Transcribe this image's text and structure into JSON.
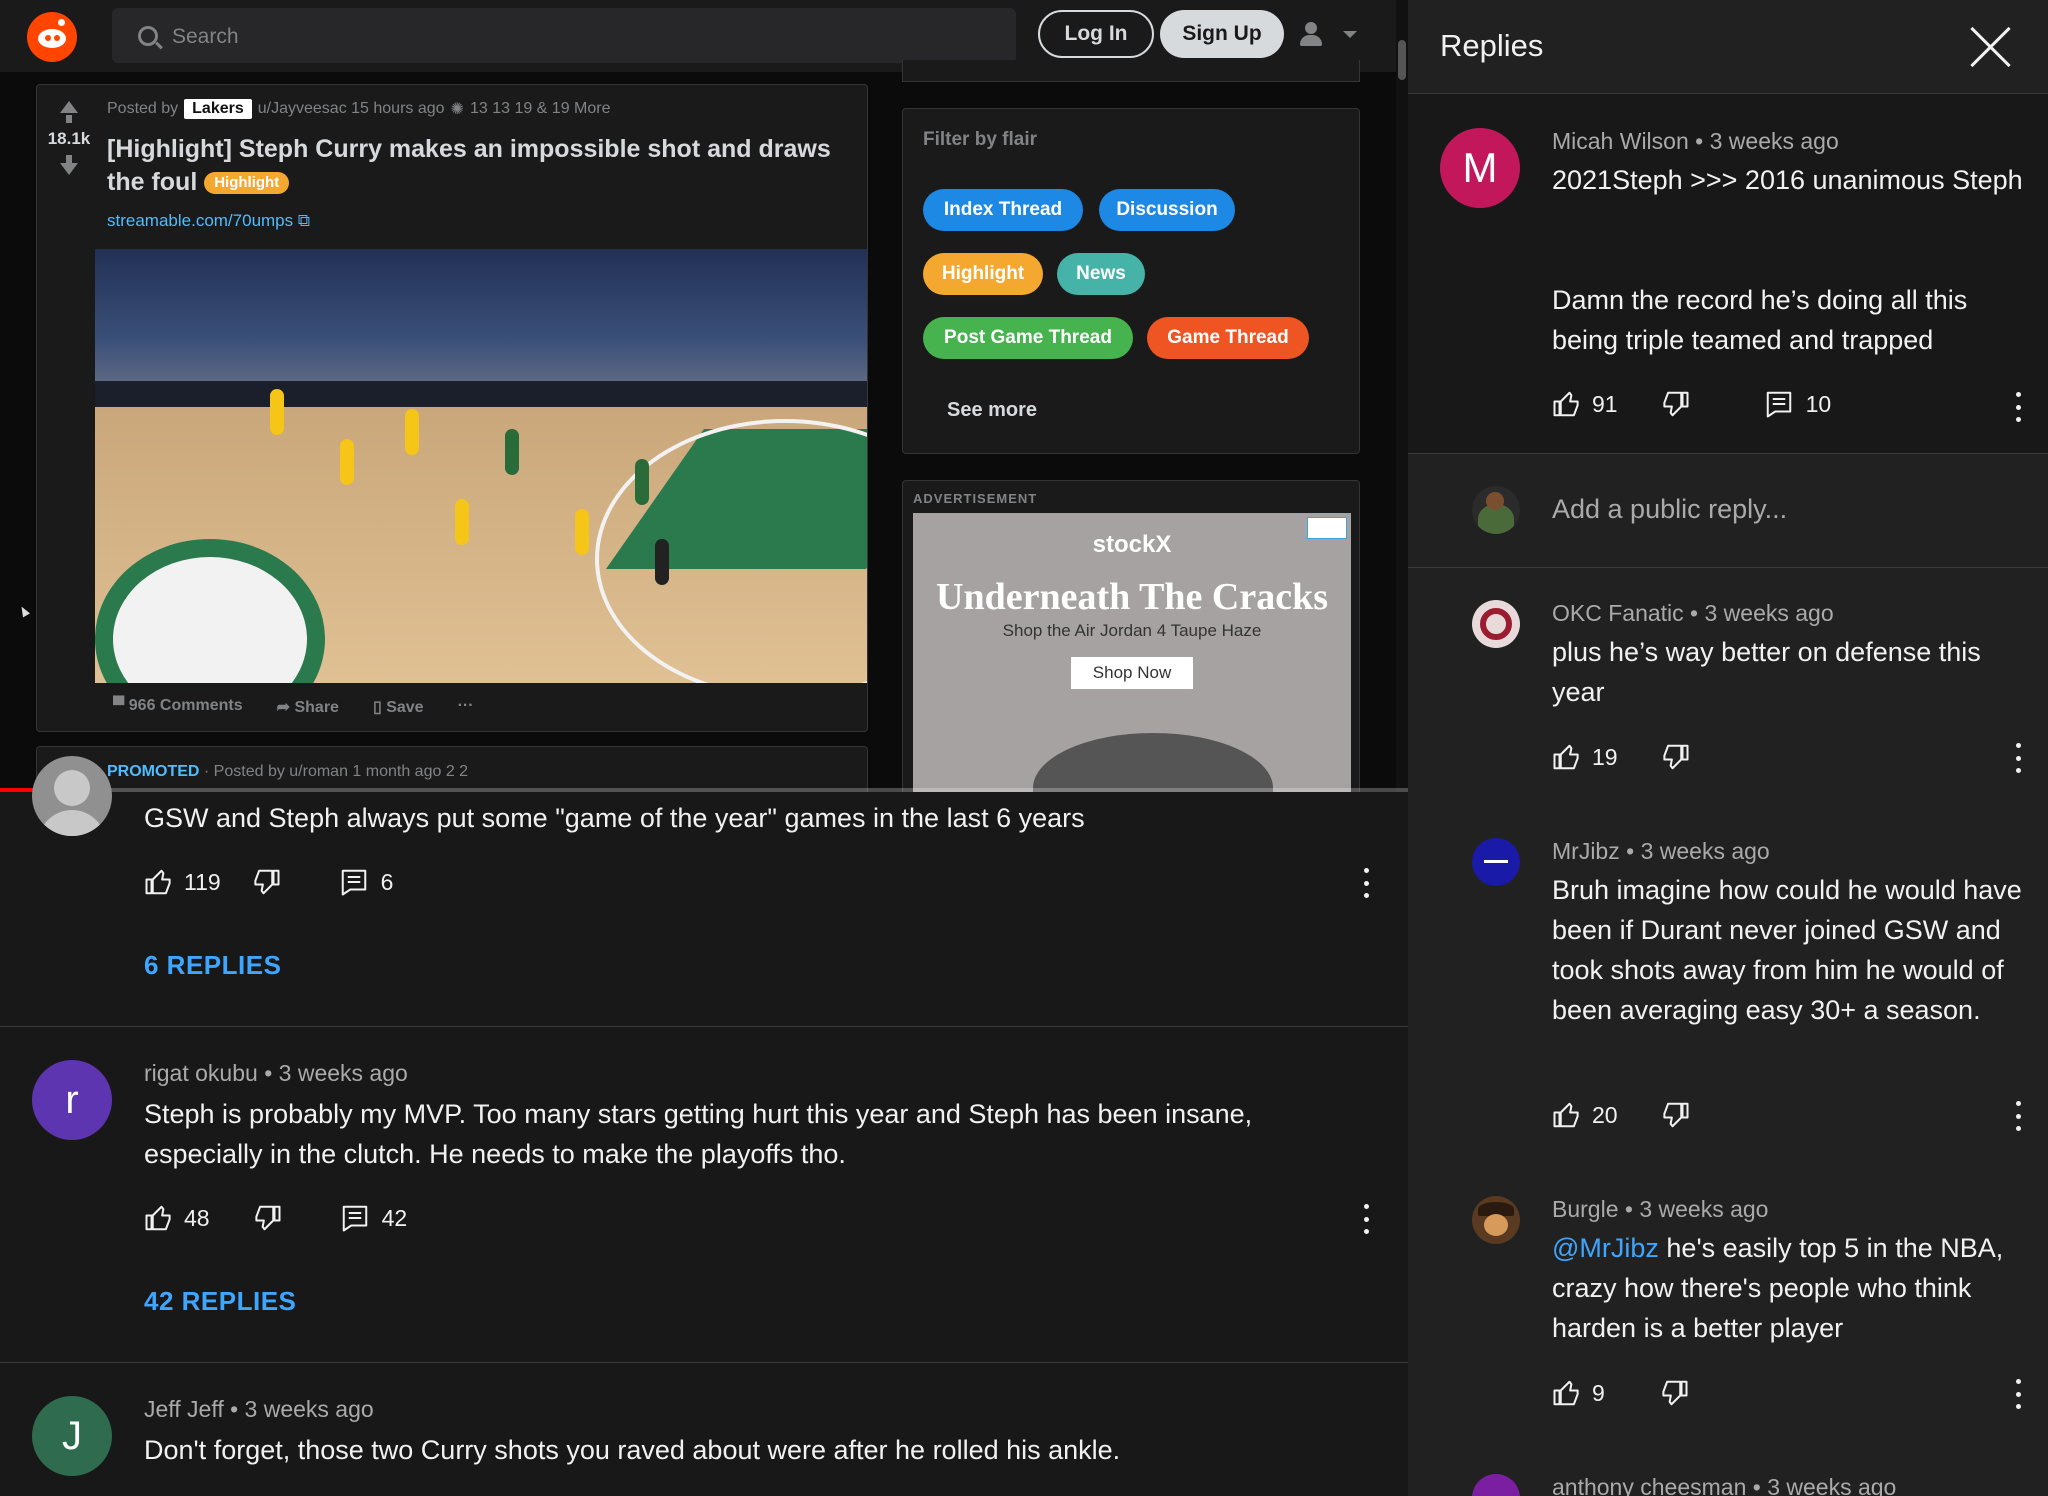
{
  "reddit": {
    "search_placeholder": "Search",
    "login": "Log In",
    "signup": "Sign Up",
    "post": {
      "score": "18.1k",
      "posted_by": "Posted by",
      "subreddit": "Lakers",
      "author_time": "u/Jayveesac 15 hours ago",
      "awards_text": "13   13   19 & 19 More",
      "title": "[Highlight] Steph Curry makes an impossible shot and draws the foul",
      "flair": "Highlight",
      "link": "streamable.com/70umps",
      "comments": "966 Comments",
      "share": "Share",
      "save": "Save",
      "more": "···"
    },
    "promoted": {
      "tag": "PROMOTED",
      "meta": "· Posted by u/roman 1 month ago",
      "awards": "2   2"
    },
    "flair_filter": {
      "header": "Filter by flair",
      "chips": [
        {
          "label": "Index Thread",
          "color": "#1e88e5"
        },
        {
          "label": "Discussion",
          "color": "#1e88e5"
        },
        {
          "label": "Highlight",
          "color": "#f4a830"
        },
        {
          "label": "News",
          "color": "#46b3a9"
        },
        {
          "label": "Post Game Thread",
          "color": "#46b34f"
        },
        {
          "label": "Game Thread",
          "color": "#ee5522"
        }
      ],
      "see_more": "See more"
    },
    "ad": {
      "label": "ADVERTISEMENT",
      "brand": "stockX",
      "headline": "Underneath The Cracks",
      "subline": "Shop the Air Jordan 4 Taupe Haze",
      "cta": "Shop Now"
    }
  },
  "video": {
    "progress": 0.06
  },
  "comments": [
    {
      "author": "",
      "time": "",
      "text": "GSW and Steph always put some \"game of the year\" games in the last 6 years",
      "likes": "119",
      "reply_count": "6",
      "replies_button": "6 REPLIES",
      "avatar_letter": "",
      "avatar_color": "#909090"
    },
    {
      "author": "rigat okubu",
      "time": "3 weeks ago",
      "text": "Steph is probably my MVP. Too many stars getting hurt this year and Steph has been insane, especially in the clutch. He needs to make the playoffs tho.",
      "likes": "48",
      "reply_count": "42",
      "replies_button": "42 REPLIES",
      "avatar_letter": "r",
      "avatar_color": "#5e35b1"
    },
    {
      "author": "Jeff Jeff",
      "time": "3 weeks ago",
      "text": "Don't forget, those two Curry shots you raved about were after he rolled his ankle.",
      "avatar_letter": "J",
      "avatar_color": "#2e6b4f"
    }
  ],
  "replies_panel": {
    "title": "Replies",
    "parent": {
      "author": "Micah Wilson",
      "time": "3 weeks ago",
      "text_1": "2021Steph >>> 2016 unanimous Steph",
      "text_2": "Damn the record he’s doing all this being triple teamed and  trapped",
      "likes": "91",
      "reply_count": "10",
      "avatar_letter": "M",
      "avatar_color": "#c2185b"
    },
    "add_reply_placeholder": "Add a public reply...",
    "replies": [
      {
        "author": "OKC Fanatic",
        "time": "3 weeks ago",
        "text": "plus he’s way better on defense this year",
        "likes": "19"
      },
      {
        "author": "MrJibz",
        "time": "3 weeks ago",
        "text": "Bruh imagine how could he would have been if Durant never joined GSW and took shots away from him he would of been averaging easy 30+ a season.",
        "likes": "20"
      },
      {
        "author": "Burgle",
        "time": "3 weeks ago",
        "mention": "@MrJibz",
        "text": " he's easily top 5 in the NBA, crazy how there's people who think harden is a better player",
        "likes": "9"
      },
      {
        "author": "anthony cheesman",
        "time": "3 weeks ago"
      }
    ],
    "sep": "•"
  }
}
